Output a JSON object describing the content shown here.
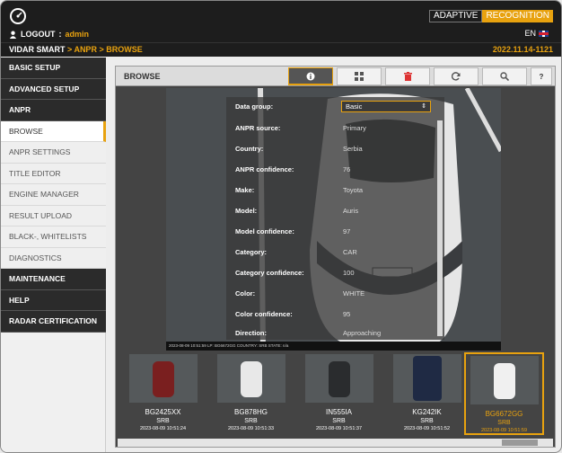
{
  "header": {
    "logout_label": "LOGOUT",
    "colon": ":",
    "user": "admin",
    "brand_left": "ADAPTIVE",
    "brand_right": "RECOGNITION",
    "language": "EN"
  },
  "breadcrumb": {
    "root": "VIDAR SMART",
    "path": "> ANPR > BROWSE",
    "version": "2022.11.14-1121"
  },
  "sidebar": {
    "items": [
      {
        "label": "BASIC SETUP"
      },
      {
        "label": "ADVANCED SETUP"
      },
      {
        "label": "ANPR"
      },
      {
        "label": "BROWSE"
      },
      {
        "label": "ANPR SETTINGS"
      },
      {
        "label": "TITLE EDITOR"
      },
      {
        "label": "ENGINE MANAGER"
      },
      {
        "label": "RESULT UPLOAD"
      },
      {
        "label": "BLACK-, WHITELISTS"
      },
      {
        "label": "DIAGNOSTICS"
      },
      {
        "label": "MAINTENANCE"
      },
      {
        "label": "HELP"
      },
      {
        "label": "RADAR CERTIFICATION"
      }
    ]
  },
  "toolbar": {
    "title": "BROWSE",
    "help_label": "?"
  },
  "info": {
    "data_group_label": "Data group:",
    "data_group_value": "Basic",
    "rows": [
      {
        "label": "ANPR source:",
        "value": "Primary"
      },
      {
        "label": "Country:",
        "value": "Serbia"
      },
      {
        "label": "ANPR confidence:",
        "value": "76"
      },
      {
        "label": "Make:",
        "value": "Toyota"
      },
      {
        "label": "Model:",
        "value": "Auris"
      },
      {
        "label": "Model confidence:",
        "value": "97"
      },
      {
        "label": "Category:",
        "value": "CAR"
      },
      {
        "label": "Category confidence:",
        "value": "100"
      },
      {
        "label": "Color:",
        "value": "WHITE"
      },
      {
        "label": "Color confidence:",
        "value": "95"
      },
      {
        "label": "Direction:",
        "value": "Approaching"
      }
    ],
    "caption": "2023-08-09 10:51:59 LP: BG6672GG COUNTRY: SRB STATE: n/a"
  },
  "thumbnails": [
    {
      "plate": "BG2425XX",
      "country": "SRB",
      "time": "2023-08-09 10:51:24",
      "car_color": "#7a1f1f"
    },
    {
      "plate": "BG878HG",
      "country": "SRB",
      "time": "2023-08-09 10:51:33",
      "car_color": "#e8e8e8"
    },
    {
      "plate": "IN555IA",
      "country": "SRB",
      "time": "2023-08-09 10:51:37",
      "car_color": "#2a2c2e"
    },
    {
      "plate": "KG242IK",
      "country": "SRB",
      "time": "2023-08-09 10:51:52",
      "car_color": "#1f2a44"
    },
    {
      "plate": "BG6672GG",
      "country": "SRB",
      "time": "2023-08-09 10:51:59",
      "car_color": "#f0f0f0"
    }
  ],
  "colors": {
    "accent": "#e8a20f",
    "header_bg": "#1d1d1d"
  }
}
